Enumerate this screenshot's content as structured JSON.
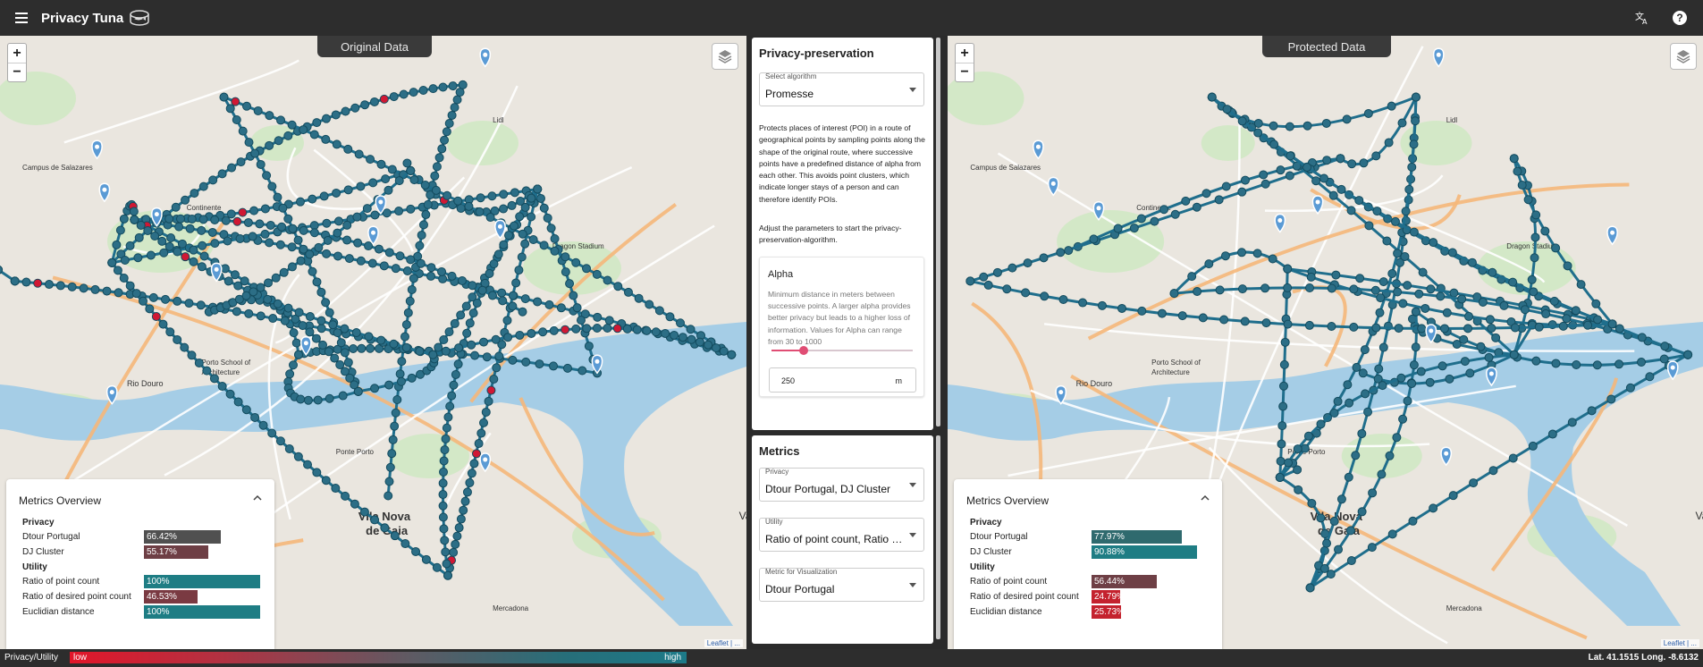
{
  "app": {
    "title": "Privacy Tuna",
    "menu_icon": "hamburger-menu-icon",
    "logo_icon": "tuna-can-logo-icon",
    "translate_icon": "translate-icon",
    "help_icon": "help-icon"
  },
  "maps": {
    "original": {
      "title": "Original Data"
    },
    "protected": {
      "title": "Protected Data"
    },
    "zoom_in": "+",
    "zoom_out": "−",
    "layers_icon": "layers-icon",
    "attribution": "Leaflet | ...",
    "place_labels": {
      "vila_nova": "Vila Nova",
      "de_gaia": "de Gaia",
      "rio_douro": "Rio Douro",
      "porto_school": "Porto School of",
      "architecture": "Architecture",
      "dragon_stadium": "Dragon Stadium",
      "campus": "Campus de Salazares",
      "ponte_porto": "Ponte Porto",
      "continente": "Continente",
      "mercadona": "Mercadona",
      "lidl": "Lidl",
      "valbom": "Valbom"
    }
  },
  "metrics_overview": {
    "title": "Metrics Overview",
    "privacy_heading": "Privacy",
    "utility_heading": "Utility",
    "original": {
      "privacy": [
        {
          "label": "Dtour Portugal",
          "value": "66.42%",
          "ratio": 0.6642,
          "color": "#505050"
        },
        {
          "label": "DJ Cluster",
          "value": "55.17%",
          "ratio": 0.5517,
          "color": "#6e3f45"
        }
      ],
      "utility": [
        {
          "label": "Ratio of point count",
          "value": "100%",
          "ratio": 1.0,
          "color": "#1e7d84"
        },
        {
          "label": "Ratio of desired point count",
          "value": "46.53%",
          "ratio": 0.4653,
          "color": "#7a3a42"
        },
        {
          "label": "Euclidian distance",
          "value": "100%",
          "ratio": 1.0,
          "color": "#1e7d84"
        }
      ]
    },
    "protected": {
      "privacy": [
        {
          "label": "Dtour Portugal",
          "value": "77.97%",
          "ratio": 0.7797,
          "color": "#2f6a6e"
        },
        {
          "label": "DJ Cluster",
          "value": "90.88%",
          "ratio": 0.9088,
          "color": "#1e7d84"
        }
      ],
      "utility": [
        {
          "label": "Ratio of point count",
          "value": "56.44%",
          "ratio": 0.5644,
          "color": "#6e3f45"
        },
        {
          "label": "Ratio of desired point count",
          "value": "24.79%",
          "ratio": 0.2479,
          "color": "#c4222e"
        },
        {
          "label": "Euclidian distance",
          "value": "25.73%",
          "ratio": 0.2573,
          "color": "#c4222e"
        }
      ]
    }
  },
  "privacy_preservation": {
    "title": "Privacy-preservation",
    "algorithm_caption": "Select algorithm",
    "algorithm_value": "Promesse",
    "description": "Protects places of interest (POI) in a route of geographical points by sampling points along the shape of the original route, where successive points have a predefined distance of alpha from each other. This avoids point clusters, which indicate longer stays of a person and can therefore identify POIs.",
    "instructions": "Adjust the parameters to start the privacy-preservation-algorithm.",
    "alpha": {
      "title": "Alpha",
      "description": "Minimum distance in meters between successive points. A larger alpha provides better privacy but leads to a higher loss of information. Values for Alpha can range from 30 to 1000",
      "value": "250",
      "unit": "m",
      "min": 30,
      "max": 1000
    }
  },
  "metrics_panel": {
    "title": "Metrics",
    "privacy_caption": "Privacy",
    "privacy_value": "Dtour Portugal, DJ Cluster",
    "utility_caption": "Utility",
    "utility_value": "Ratio of point count, Ratio of desired point count, Euclidian distance",
    "visualization_caption": "Metric for Visualization",
    "visualization_value": "Dtour Portugal"
  },
  "bottom": {
    "label": "Privacy/Utility",
    "low": "low",
    "high": "high",
    "coords": "Lat. 41.1515 Long. -8.6132"
  },
  "colors": {
    "route": "#1f6e8c",
    "point": "#2c6e86",
    "highlight": "#d01834",
    "marker": "#5b9bd5",
    "water": "#a5cde6",
    "land": "#eae6df",
    "green": "#cde8c1",
    "accent": "#e04d74"
  }
}
